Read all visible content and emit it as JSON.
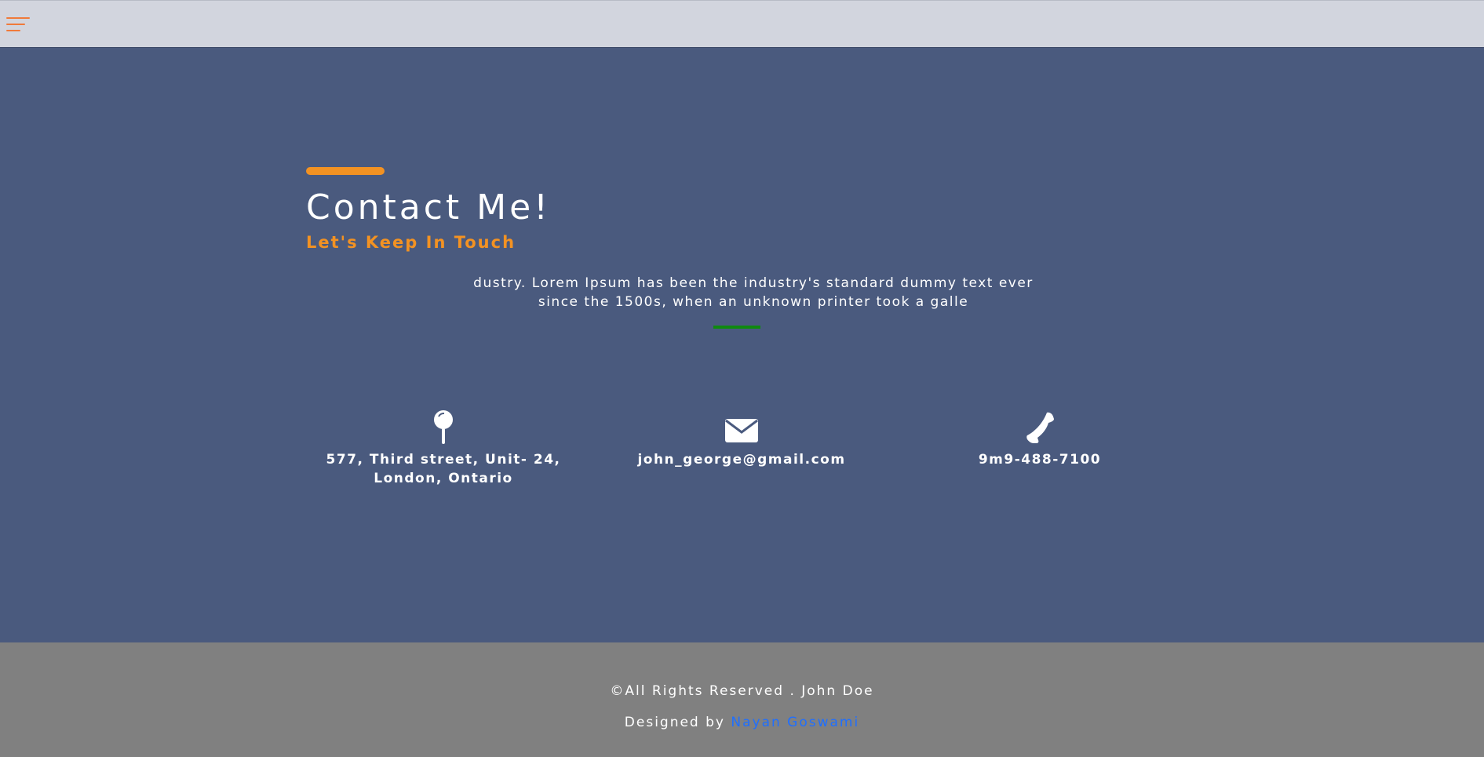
{
  "header": {
    "menu_icon": "hamburger-menu-icon",
    "accent_color": "#f07a3a"
  },
  "contact": {
    "title": "Contact Me!",
    "subtitle": "Let's Keep In Touch",
    "paragraph": "dustry. Lorem Ipsum has been the industry's standard dummy text ever since the 1500s, when an unknown printer took a galle",
    "accent_color": "#f39222",
    "divider_color": "#0f8a0f"
  },
  "info": {
    "address": {
      "icon": "map-pin-icon",
      "line1": "577, Third street, Unit- 24,",
      "line2": "London, Ontario"
    },
    "email": {
      "icon": "envelope-icon",
      "value": "john_george@gmail.com"
    },
    "phone": {
      "icon": "phone-icon",
      "value": "9m9-488-7100"
    }
  },
  "footer": {
    "rights": "©All Rights Reserved . John Doe",
    "designed_by_prefix": "Designed by ",
    "designer_name": "Nayan Goswami",
    "link_color": "#1f6fff"
  },
  "colors": {
    "background": "#4a5a7e",
    "topbar": "#d2d5de",
    "footer": "#808080"
  }
}
